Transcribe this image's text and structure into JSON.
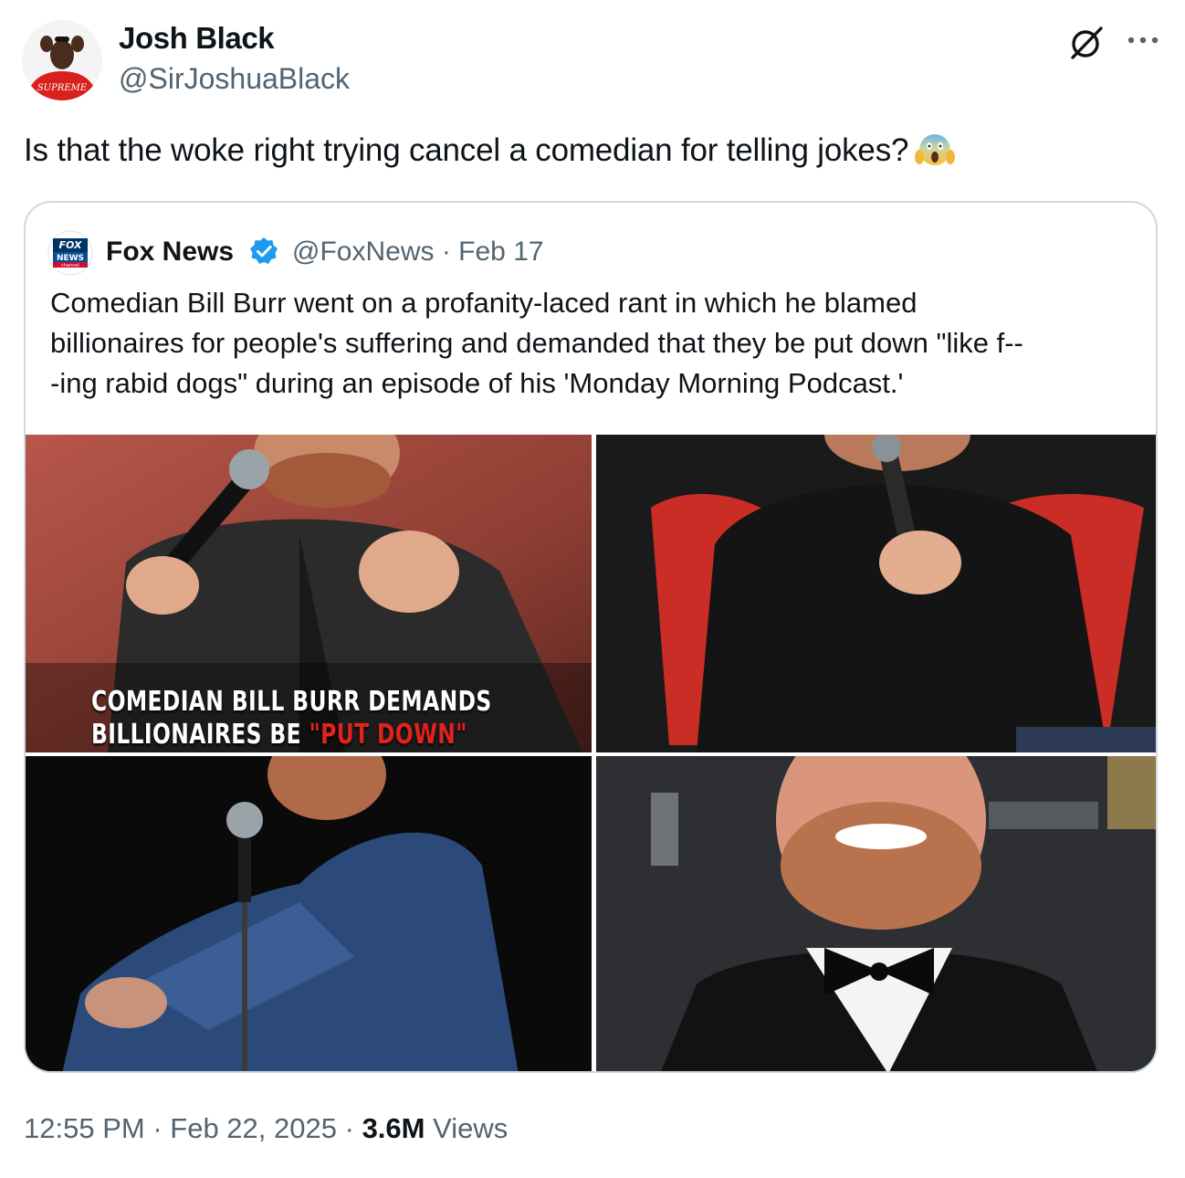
{
  "author": {
    "display_name": "Josh Black",
    "handle": "@SirJoshuaBlack",
    "avatar_text": "SUPREME"
  },
  "tweet": {
    "text": "Is that the woke right trying cancel a comedian for telling jokes?",
    "emoji": "face-screaming-in-fear"
  },
  "quoted": {
    "name": "Fox News",
    "handle": "@FoxNews",
    "separator": "·",
    "date": "Feb 17",
    "verified_color": "#1d9bf0",
    "text_lines": [
      "Comedian Bill Burr went on a profanity-laced rant in which he blamed",
      "billionaires for people's suffering and demanded that they be put down \"like f--",
      "-ing rabid dogs\" during an episode of his 'Monday Morning Podcast.'"
    ],
    "media_caption": {
      "line1": "COMEDIAN BILL BURR DEMANDS",
      "line2_prefix": "BILLIONAIRES BE ",
      "line2_highlight": "\"PUT DOWN\""
    },
    "logo_text": {
      "top": "FOX",
      "middle": "NEWS",
      "bottom": "channel"
    }
  },
  "footer": {
    "time": "12:55 PM",
    "separator": "·",
    "date": "Feb 22, 2025",
    "views_count": "3.6M",
    "views_label": "Views"
  }
}
